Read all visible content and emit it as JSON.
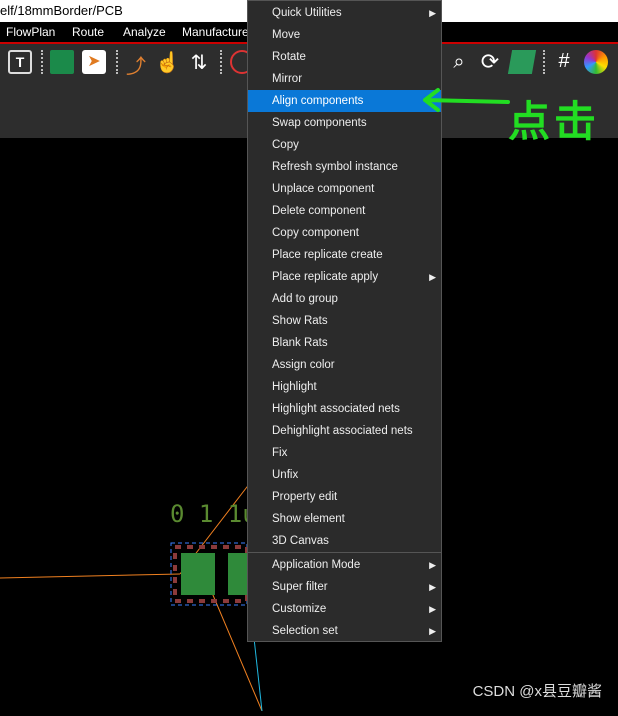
{
  "window": {
    "title": "elf/18mmBorder/PCB"
  },
  "menubar": {
    "items": [
      "FlowPlan",
      "Route",
      "Analyze",
      "Manufacture"
    ]
  },
  "toolbar": {
    "icons": [
      "text-edit-icon",
      "component-place-icon",
      "chip-select-icon",
      "route-icon",
      "hand-move-icon",
      "swap-icon",
      "drc-icon",
      "zoom-icon",
      "refresh-icon",
      "board-3d-icon",
      "grid-icon",
      "color-wheel-icon"
    ]
  },
  "context_menu": {
    "items": [
      {
        "label": "Quick Utilities",
        "submenu": true
      },
      {
        "label": "Move"
      },
      {
        "label": "Rotate"
      },
      {
        "label": "Mirror"
      },
      {
        "label": "Align components",
        "highlighted": true
      },
      {
        "label": "Swap components"
      },
      {
        "label": "Copy"
      },
      {
        "label": "Refresh symbol instance"
      },
      {
        "label": "Unplace component"
      },
      {
        "label": "Delete component"
      },
      {
        "label": "Copy component"
      },
      {
        "label": "Place replicate create"
      },
      {
        "label": "Place replicate apply",
        "submenu": true
      },
      {
        "label": "Add to group"
      },
      {
        "label": "Show Rats"
      },
      {
        "label": "Blank Rats"
      },
      {
        "label": "Assign color"
      },
      {
        "label": "Highlight"
      },
      {
        "label": "Highlight associated nets"
      },
      {
        "label": "Dehighlight associated nets"
      },
      {
        "label": "Fix"
      },
      {
        "label": "Unfix"
      },
      {
        "label": "Property edit"
      },
      {
        "label": "Show element"
      },
      {
        "label": "3D Canvas"
      },
      {
        "label": "Application Mode",
        "submenu": true
      },
      {
        "label": "Super filter",
        "submenu": true
      },
      {
        "label": "Customize",
        "submenu": true
      },
      {
        "label": "Selection set",
        "submenu": true
      }
    ]
  },
  "canvas": {
    "component_label": "0 1 1u"
  },
  "annotation": {
    "text": "点击",
    "color": "#22dd22"
  },
  "watermark": "CSDN @x县豆瓣酱",
  "colors": {
    "highlight": "#0a78d7",
    "accent_line": "#cc0000"
  }
}
